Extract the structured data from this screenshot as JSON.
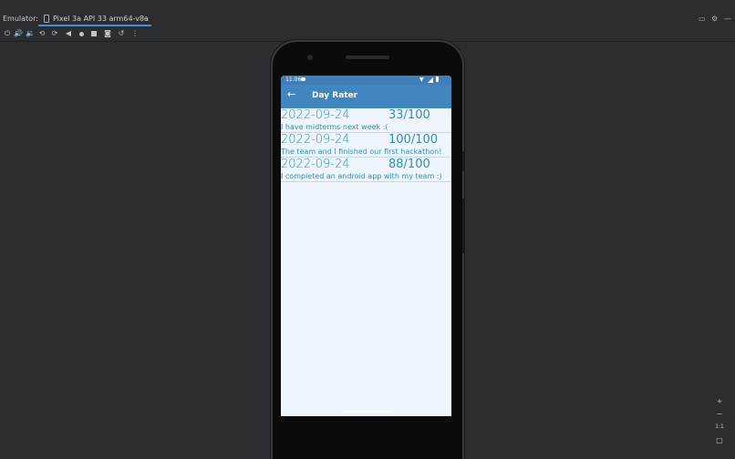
{
  "emulator": {
    "panel_label": "Emulator:",
    "tab_title": "Pixel 3a API 33 arm64-v8a",
    "tab_close": "×",
    "right_controls": [
      "layout-icon",
      "settings-icon",
      "minimize-icon"
    ]
  },
  "toolbar": {
    "icons": [
      "power-icon",
      "volume-up-icon",
      "volume-down-icon",
      "rotate-left-icon",
      "rotate-right-icon",
      "back-icon",
      "home-icon",
      "overview-icon",
      "screenshot-icon",
      "snapshot-icon",
      "more-icon"
    ]
  },
  "device": {
    "status": {
      "time": "11:06"
    },
    "app": {
      "title": "Day Rater",
      "back_glyph": "←",
      "entries": [
        {
          "date": "2022-09-24",
          "score": "33/100",
          "note": "I have midterms next week :("
        },
        {
          "date": "2022-09-24",
          "score": "100/100",
          "note": "The team and I finished our first hackathon!"
        },
        {
          "date": "2022-09-24",
          "score": "88/100",
          "note": "I completed an android app with my team :)"
        }
      ]
    }
  },
  "zoom_controls": {
    "zoom_in": "+",
    "zoom_out": "−",
    "actual_size": "1:1",
    "fit": "□"
  },
  "colors": {
    "app_bar": "#4286c0",
    "status_bar": "#3f7eb8",
    "screen_bg": "#eef5fd",
    "text_accent": "#2e8fb8",
    "tab_underline": "#3d8ee0"
  }
}
